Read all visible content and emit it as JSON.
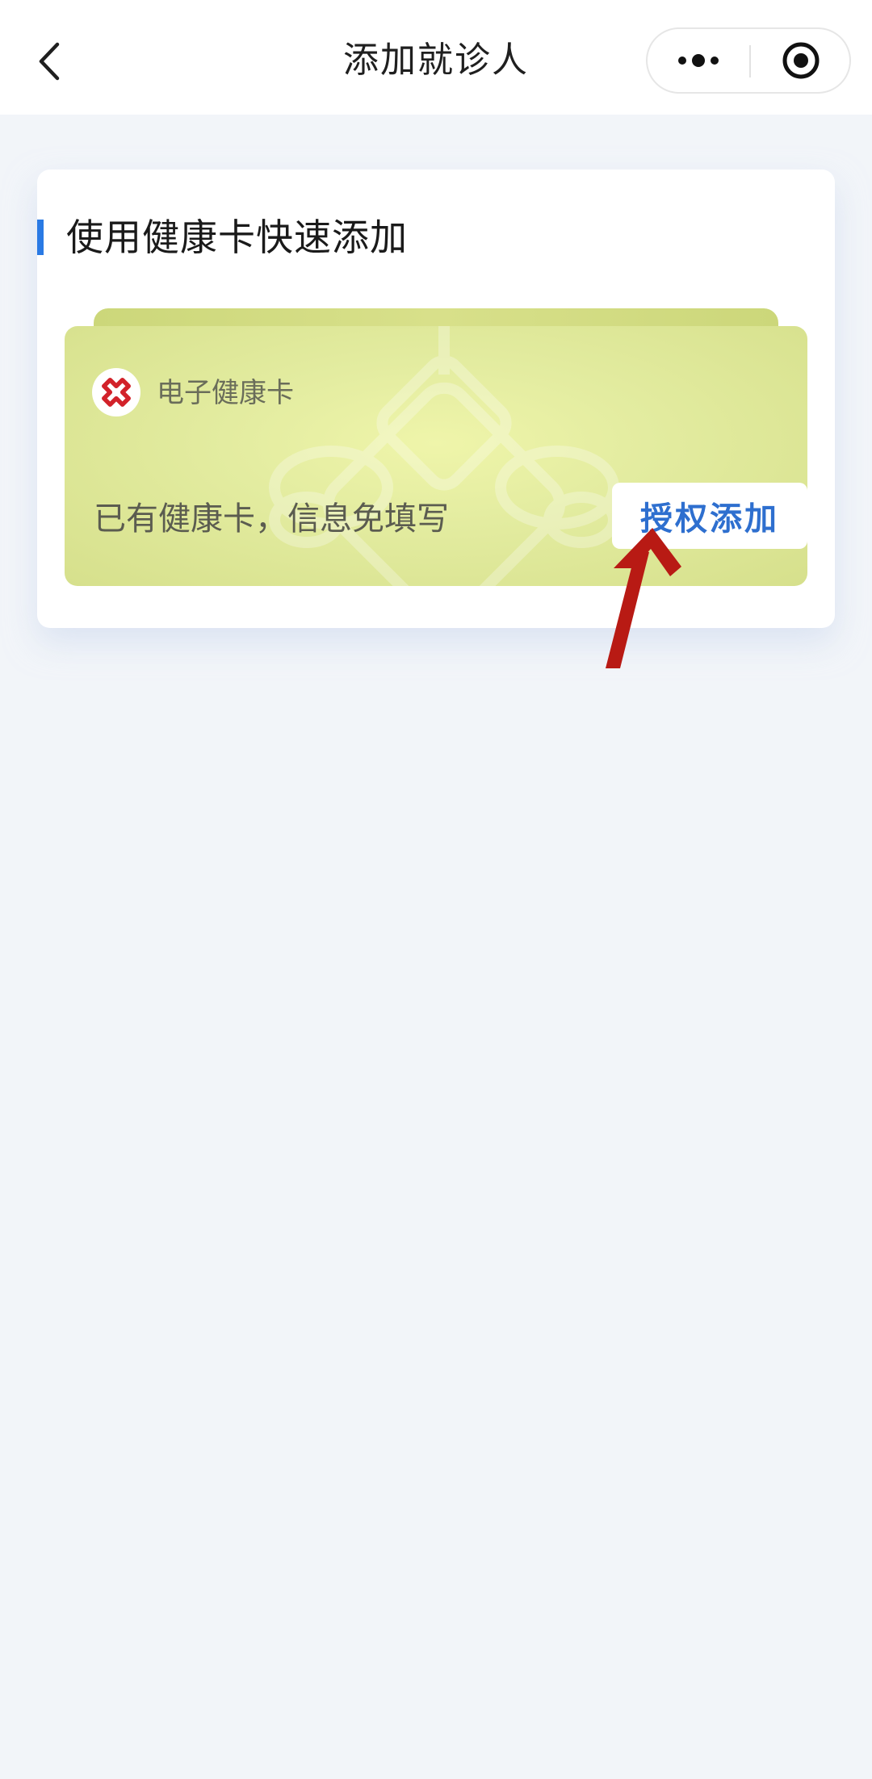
{
  "nav": {
    "title": "添加就诊人",
    "back_icon": "chevron-left-icon",
    "more_icon": "more-dots-icon",
    "close_icon": "target-close-icon"
  },
  "section": {
    "title": "使用健康卡快速添加",
    "accent_color": "#2a7ae4"
  },
  "health_card": {
    "name": "电子健康卡",
    "description": "已有健康卡，信息免填写",
    "button_label": "授权添加",
    "logo_icon": "red-cross-icon",
    "button_color": "#2e6fcf",
    "card_color": "#e3eca0"
  },
  "annotation": {
    "arrow_color": "#b81a14",
    "arrow_icon": "red-arrow-icon"
  }
}
